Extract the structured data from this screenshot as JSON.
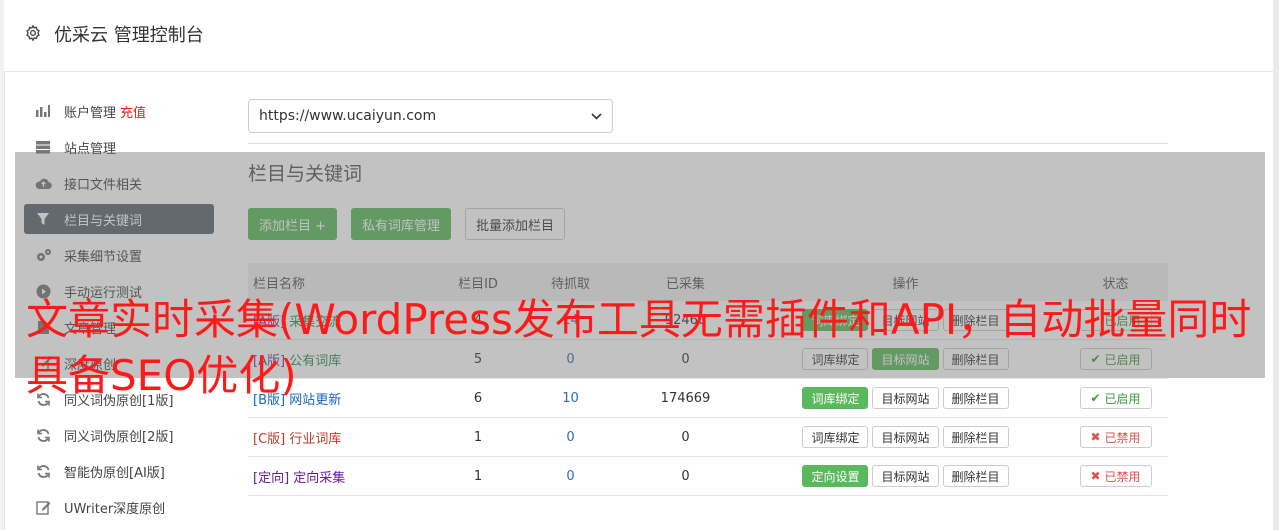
{
  "header": {
    "title": "优采云 管理控制台",
    "icon": "gear-icon"
  },
  "sidebar": {
    "items": [
      {
        "label": "账户管理",
        "extra": "充值",
        "icon": "bar-chart-icon"
      },
      {
        "label": "站点管理",
        "icon": "server-icon"
      },
      {
        "label": "接口文件相关",
        "icon": "cloud-upload-icon"
      },
      {
        "label": "栏目与关键词",
        "icon": "filter-icon",
        "active": true
      },
      {
        "label": "采集细节设置",
        "icon": "cogs-icon"
      },
      {
        "label": "手动运行测试",
        "icon": "play-icon"
      },
      {
        "label": "文章管理",
        "icon": "file-icon"
      },
      {
        "label": "深度原创",
        "icon": "edit-icon"
      },
      {
        "label": "同义词伪原创[1版]",
        "icon": "refresh-icon"
      },
      {
        "label": "同义词伪原创[2版]",
        "icon": "refresh-icon"
      },
      {
        "label": "智能伪原创[AI版]",
        "icon": "refresh-icon"
      },
      {
        "label": "UWriter深度原创",
        "icon": "pencil-icon"
      }
    ]
  },
  "site_select": {
    "value": "https://www.ucaiyun.com"
  },
  "section": {
    "title": "栏目与关键词"
  },
  "buttons": {
    "add_column": "添加栏目 +",
    "private_lexicon": "私有词库管理",
    "batch_add": "批量添加栏目"
  },
  "table": {
    "headers": {
      "name": "栏目名称",
      "id": "栏目ID",
      "pending": "待抓取",
      "done": "已采集",
      "ops": "操作",
      "status": "状态"
    },
    "rows": [
      {
        "tag": "[A版]",
        "name": "采集交流",
        "id": "4",
        "pending": "14",
        "done": "92460",
        "op1": "词库绑定",
        "op2": "目标网站",
        "op3": "删除栏目",
        "status": "已启用"
      },
      {
        "tag": "[A版]",
        "name": "公有词库",
        "id": "5",
        "pending": "0",
        "done": "0",
        "op1": "词库绑定",
        "op2": "目标网站",
        "op3": "删除栏目",
        "status": "已启用"
      },
      {
        "tag": "[B版]",
        "name": "网站更新",
        "id": "6",
        "pending": "10",
        "done": "174669",
        "op1": "词库绑定",
        "op2": "目标网站",
        "op3": "删除栏目",
        "status": "已启用"
      },
      {
        "tag": "[C版]",
        "name": "行业词库",
        "id": "1",
        "pending": "0",
        "done": "0",
        "op1": "词库绑定",
        "op2": "目标网站",
        "op3": "删除栏目",
        "status": "已禁用"
      },
      {
        "tag": "[定向]",
        "name": "定向采集",
        "id": "1",
        "pending": "0",
        "done": "0",
        "op1": "定向设置",
        "op2": "目标网站",
        "op3": "删除栏目",
        "status": "已禁用"
      }
    ]
  },
  "banner": {
    "text": "文章实时采集(WordPress发布工具无需插件和API，自动批量同时具备SEO优化)"
  },
  "colors": {
    "green": "#5cb85c",
    "active_nav": "#5b6670",
    "banner_red": "#ff1a1a"
  }
}
